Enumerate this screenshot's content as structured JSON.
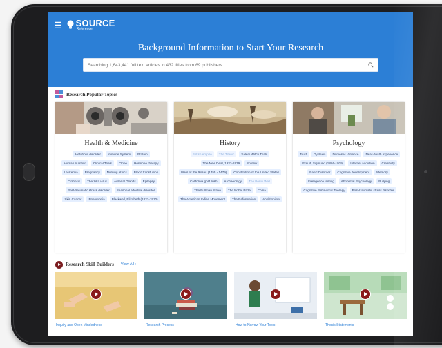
{
  "app": {
    "logo_main": "SOURCE",
    "logo_sub": "Reference"
  },
  "hero": {
    "title": "Background Information to Start Your Research",
    "search_placeholder": "Searching 1,643,441 full text articles in 432 titles from 69 publishers"
  },
  "topics": {
    "heading": "Research Popular Topics",
    "cards": [
      {
        "title": "Health & Medicine",
        "tags": [
          "Metabolic disorder",
          "Immune System",
          "Protein",
          "Human nutrition",
          "Clinical Trials",
          "Clone",
          "Hormone therapy",
          "Leukemia",
          "Pregnancy",
          "Nursing ethics",
          "Blood transfusion",
          "Cirrhosis",
          "The Zika virus",
          "Adrenal Glands",
          "Epilepsy",
          "Post-traumatic stress disorder",
          "Seasonal affective disorder",
          "Skin Cancer",
          "Pneumonia",
          "Blackwell, Elizabeth (1821-1910)"
        ]
      },
      {
        "title": "History",
        "tags": [
          "British empire",
          "The Titanic",
          "Salem Witch Trials",
          "The New Deal, 1933-1939",
          "Sputnik",
          "Wars of the Roses (1455 - 1479)",
          "Constitution of the United States",
          "California gold rush",
          "Archaeology",
          "The Berlin Wall",
          "The Pullman Strike",
          "The Nobel Prize",
          "China",
          "The American Indian Movement",
          "The Reformation",
          "Abolitionism"
        ]
      },
      {
        "title": "Psychology",
        "tags": [
          "Trust",
          "Dyslexia",
          "Domestic Violence",
          "Near-death experience",
          "Freud, Sigmund (1856-1939)",
          "Internet addiction",
          "Creativity",
          "Panic Disorder",
          "Cognitive development",
          "Memory",
          "Intelligence testing",
          "Abnormal Psychology",
          "Bullying",
          "Cognitive Behavioral Therapy",
          "Post-traumatic stress disorder"
        ]
      }
    ]
  },
  "skills": {
    "heading": "Research Skill Builders",
    "view_all": "View All ›",
    "items": [
      {
        "label": "Inquiry and Open Mindedness"
      },
      {
        "label": "Research Process"
      },
      {
        "label": "How to Narrow Your Topic"
      },
      {
        "label": "Thesis Statements"
      }
    ]
  },
  "colors": {
    "brand_blue": "#2c7fd6",
    "tag_bg": "#e5efff",
    "tag_text": "#33466b",
    "play_red": "#8a1a1a"
  }
}
